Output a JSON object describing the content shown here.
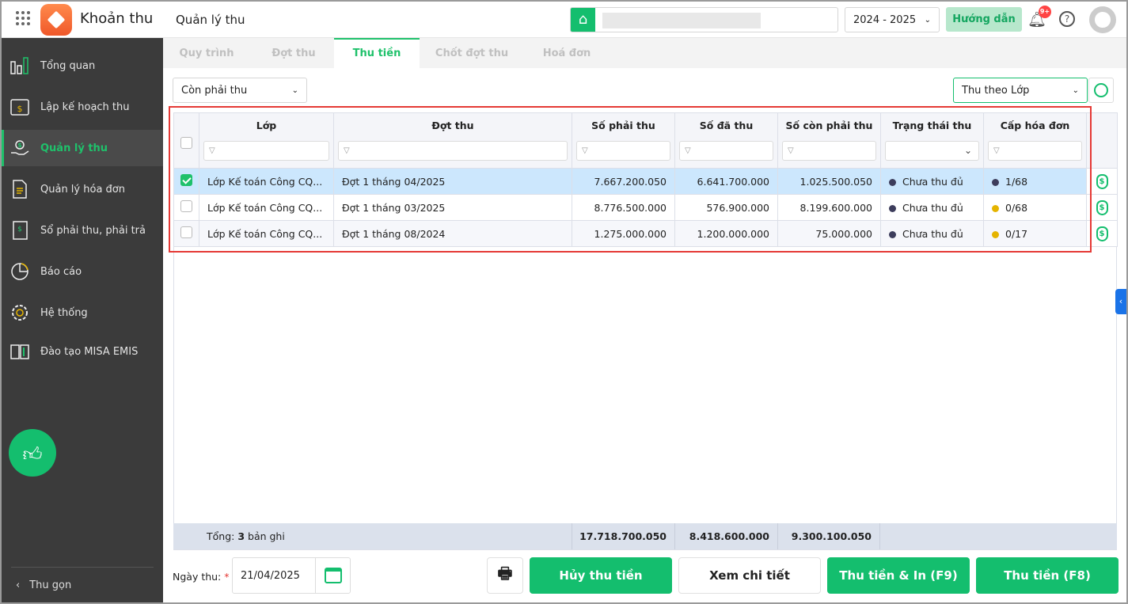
{
  "app": {
    "name": "Khoản thu",
    "page_title": "Quản lý thu"
  },
  "header": {
    "school_year": "2024 - 2025",
    "guide_label": "Hướng dẫn",
    "notif_badge": "9+"
  },
  "sidebar": {
    "items": [
      {
        "label": "Tổng quan",
        "icon": "chart-icon"
      },
      {
        "label": "Lập kế hoạch thu",
        "icon": "calendar-dollar-icon"
      },
      {
        "label": "Quản lý thu",
        "icon": "hand-coin-icon",
        "active": true
      },
      {
        "label": "Quản lý hóa đơn",
        "icon": "document-icon"
      },
      {
        "label": "Sổ phải thu, phải trả",
        "icon": "ledger-icon"
      },
      {
        "label": "Báo cáo",
        "icon": "pie-chart-icon"
      },
      {
        "label": "Hệ thống",
        "icon": "gear-icon"
      },
      {
        "label": "Đào tạo MISA EMIS",
        "icon": "book-icon"
      }
    ],
    "collapse_label": "Thu gọn"
  },
  "tabs": [
    {
      "label": "Quy trình"
    },
    {
      "label": "Đợt thu"
    },
    {
      "label": "Thu tiền",
      "active": true
    },
    {
      "label": "Chốt đợt thu"
    },
    {
      "label": "Hoá đơn"
    }
  ],
  "filters": {
    "status": "Còn phải thu",
    "mode": "Thu theo Lớp"
  },
  "table": {
    "columns": [
      "Lớp",
      "Đợt thu",
      "Số phải thu",
      "Số đã thu",
      "Số còn phải thu",
      "Trạng thái thu",
      "Cấp hóa đơn"
    ],
    "rows": [
      {
        "lop": "Lớp Kế toán Công CQ...",
        "dot": "Đợt 1 tháng 04/2025",
        "phai": "7.667.200.050",
        "da": "6.641.700.000",
        "con": "1.025.500.050",
        "status": "Chưa thu đủ",
        "invoice": "1/68",
        "invoice_color": "#3d3d5c",
        "checked": true
      },
      {
        "lop": "Lớp Kế toán Công CQ...",
        "dot": "Đợt 1 tháng 03/2025",
        "phai": "8.776.500.000",
        "da": "576.900.000",
        "con": "8.199.600.000",
        "status": "Chưa thu đủ",
        "invoice": "0/68",
        "invoice_color": "#e5b400",
        "checked": false
      },
      {
        "lop": "Lớp Kế toán Công CQ...",
        "dot": "Đợt 1 tháng 08/2024",
        "phai": "1.275.000.000",
        "da": "1.200.000.000",
        "con": "75.000.000",
        "status": "Chưa thu đủ",
        "invoice": "0/17",
        "invoice_color": "#e5b400",
        "checked": false
      }
    ],
    "footer": {
      "prefix": "Tổng: ",
      "count": "3",
      "suffix": " bản ghi",
      "phai": "17.718.700.050",
      "da": "8.418.600.000",
      "con": "9.300.100.050"
    }
  },
  "bottom": {
    "date_label": "Ngày thu:",
    "required": "*",
    "date": "21/04/2025",
    "cancel": "Hủy thu tiền",
    "detail": "Xem chi tiết",
    "collect_print": "Thu tiền & In (F9)",
    "collect": "Thu tiền (F8)"
  },
  "colors": {
    "accent": "#14be6e",
    "highlight": "#e53935"
  }
}
